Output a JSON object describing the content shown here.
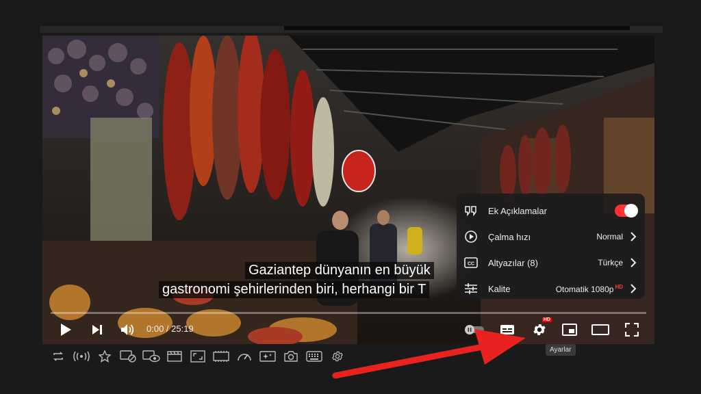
{
  "video": {
    "subtitle_line1": "Gaziantep dünyanın en büyük",
    "subtitle_line2": "gastronomi şehirlerinden biri, herhangi bir T",
    "time_display": "0:00 / 25:19",
    "progress_fraction": 0.0
  },
  "settings_menu": {
    "items": [
      {
        "label": "Ek Açıklamalar",
        "value": "",
        "toggle": true
      },
      {
        "label": "Çalma hızı",
        "value": "Normal"
      },
      {
        "label": "Altyazılar (8)",
        "value": "Türkçe"
      },
      {
        "label": "Kalite",
        "value": "Otomatik 1080p",
        "badge": "HD"
      }
    ]
  },
  "controls": {
    "settings_badge": "HD",
    "settings_tooltip": "Ayarlar"
  },
  "colors": {
    "accent": "#ff0000",
    "arrow": "#e8231f",
    "menu_bg": "#1c1c1c"
  },
  "icons": {
    "player": [
      "play-icon",
      "next-icon",
      "volume-icon",
      "autoplay-icon",
      "subtitles-icon",
      "settings-icon",
      "miniplayer-icon",
      "theater-icon",
      "fullscreen-icon"
    ],
    "toolbar": [
      "loop-icon",
      "cast-icon",
      "star-icon",
      "captions-off-icon",
      "watch-icon",
      "film-icon",
      "crop-icon",
      "frames-icon",
      "speed-icon",
      "magic-icon",
      "camera-icon",
      "keyboard-icon",
      "gear-icon"
    ]
  }
}
